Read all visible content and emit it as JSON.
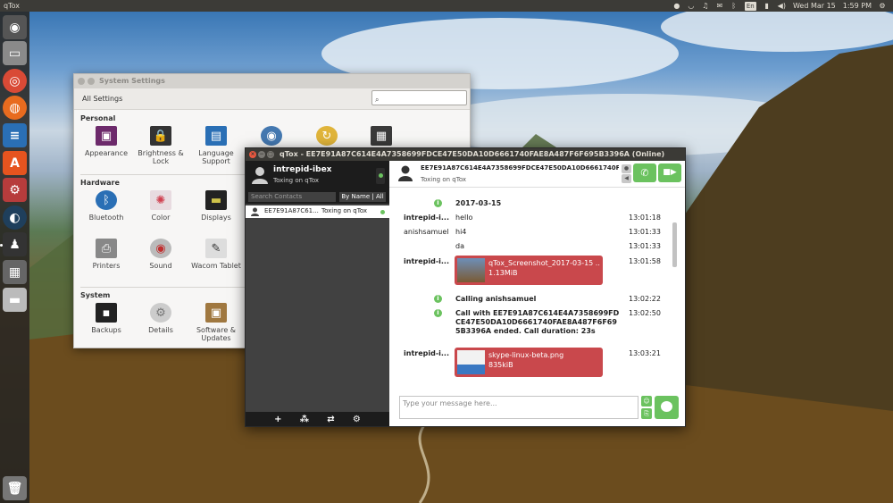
{
  "top_panel": {
    "app_name": "qTox",
    "indicators": {
      "tox_icon": "tox-tray-icon",
      "wifi_icon": "wifi-icon",
      "sound_icon": "sound-icon",
      "mail_icon": "mail-icon",
      "bluetooth_icon": "bluetooth-icon",
      "keyboard_lang": "En",
      "battery_icon": "battery-icon",
      "volume_icon": "volume-icon",
      "clock_date": "Wed Mar 15",
      "clock_time": "1:59 PM",
      "power_icon": "gear-icon"
    }
  },
  "launcher": {
    "items": [
      "ubuntu-dash-icon",
      "files-icon",
      "chrome-icon",
      "firefox-icon",
      "writer-icon",
      "software-center-icon",
      "settings-icon",
      "steam-icon",
      "qtox-icon",
      "workspaces-icon",
      "drive-icon",
      "trash-icon"
    ]
  },
  "settings": {
    "title": "System Settings",
    "all_settings": "All Settings",
    "search_placeholder": "",
    "sections": {
      "personal": "Personal",
      "hardware": "Hardware",
      "system": "System"
    },
    "personal_items": [
      {
        "label": "Appearance"
      },
      {
        "label": "Brightness & Lock"
      },
      {
        "label": "Language Support"
      }
    ],
    "hardware_items": [
      {
        "label": "Bluetooth"
      },
      {
        "label": "Color"
      },
      {
        "label": "Displays"
      }
    ],
    "hardware_items_row2": [
      {
        "label": "Printers"
      },
      {
        "label": "Sound"
      },
      {
        "label": "Wacom Tablet"
      }
    ],
    "system_items": [
      {
        "label": "Backups"
      },
      {
        "label": "Details"
      },
      {
        "label": "Software & Updates"
      }
    ]
  },
  "qtox": {
    "title": "qTox - EE7E91A87C614E4A7358699FDCE47E50DA10D6661740FAE8A487F6F695B3396A (Online)",
    "profile": {
      "name": "intrepid-ibex",
      "status": "Toxing on qTox"
    },
    "search_placeholder": "Search Contacts",
    "sort_label": "By Name | All",
    "contacts": [
      {
        "name": "EE7E91A87C61...",
        "status": "Toxing on qTox"
      }
    ],
    "footer_icons": [
      "add-icon",
      "group-icon",
      "transfer-icon",
      "gear-icon"
    ],
    "chat": {
      "header_name": "EE7E91A87C614E4A7358699FDCE47E50DA10D6661740FAE8A487F6F695...",
      "header_status": "Toxing on qTox",
      "date": "2017-03-15",
      "messages": [
        {
          "author": "intrepid-i...",
          "text": "hello",
          "time": "13:01:18"
        },
        {
          "author": "anishsamuel",
          "text": "hi4",
          "time": "13:01:33"
        },
        {
          "author": "",
          "text": "da",
          "time": "13:01:33"
        },
        {
          "author": "intrepid-i...",
          "time": "13:01:58",
          "file_name": "qTox_Screenshot_2017-03-15 ...",
          "file_size": "1.13MiB"
        },
        {
          "text": "Calling anishsamuel",
          "time": "13:02:22"
        },
        {
          "text": "Call with EE7E91A87C614E4A7358699FDCE47E50DA10D6661740FAE8A487F6F695B3396A ended. Call duration: 23s",
          "time": "13:02:50"
        },
        {
          "author": "intrepid-i...",
          "time": "13:03:21",
          "file_name": "skype-linux-beta.png",
          "file_size": "835kiB"
        }
      ],
      "composer_placeholder": "Type your message here..."
    }
  }
}
